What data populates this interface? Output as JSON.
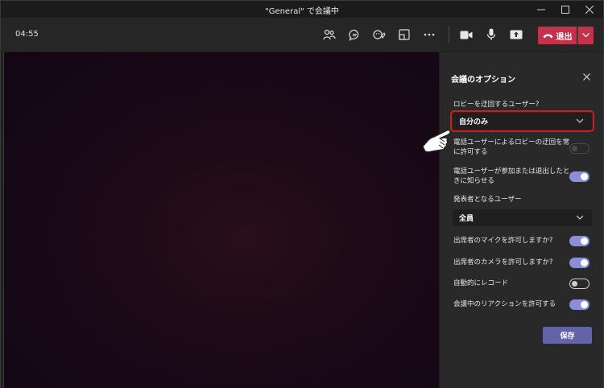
{
  "window": {
    "title": "\"General\" で会議中"
  },
  "toolbar": {
    "timer": "04:55",
    "leave_label": "退出",
    "icons": [
      "people-icon",
      "chat-icon",
      "reactions-icon",
      "rooms-icon",
      "more-icon",
      "camera-icon",
      "mic-icon",
      "share-icon"
    ],
    "leave_color": "#c4314b"
  },
  "panel": {
    "title": "会議のオプション",
    "lobby_label": "ロビーを迂回するユーザー?",
    "lobby_value": "自分のみ",
    "dialin_bypass_label": "電話ユーザーによるロビーの迂回を常に許可する",
    "dialin_bypass_state": "disabled",
    "dialin_notify_label": "電話ユーザーが参加または退出したときに知らせる",
    "dialin_notify_state": "on",
    "presenters_label": "発表者となるユーザー",
    "presenters_value": "全員",
    "allow_mic_label": "出席者のマイクを許可しますか?",
    "allow_mic_state": "on",
    "allow_camera_label": "出席者のカメラを許可しますか?",
    "allow_camera_state": "on",
    "auto_record_label": "自動的にレコード",
    "auto_record_state": "off",
    "reactions_label": "会議中のリアクションを許可する",
    "reactions_state": "on",
    "save_label": "保存",
    "accent": "#6264a7",
    "highlight": "#d01c1c"
  }
}
